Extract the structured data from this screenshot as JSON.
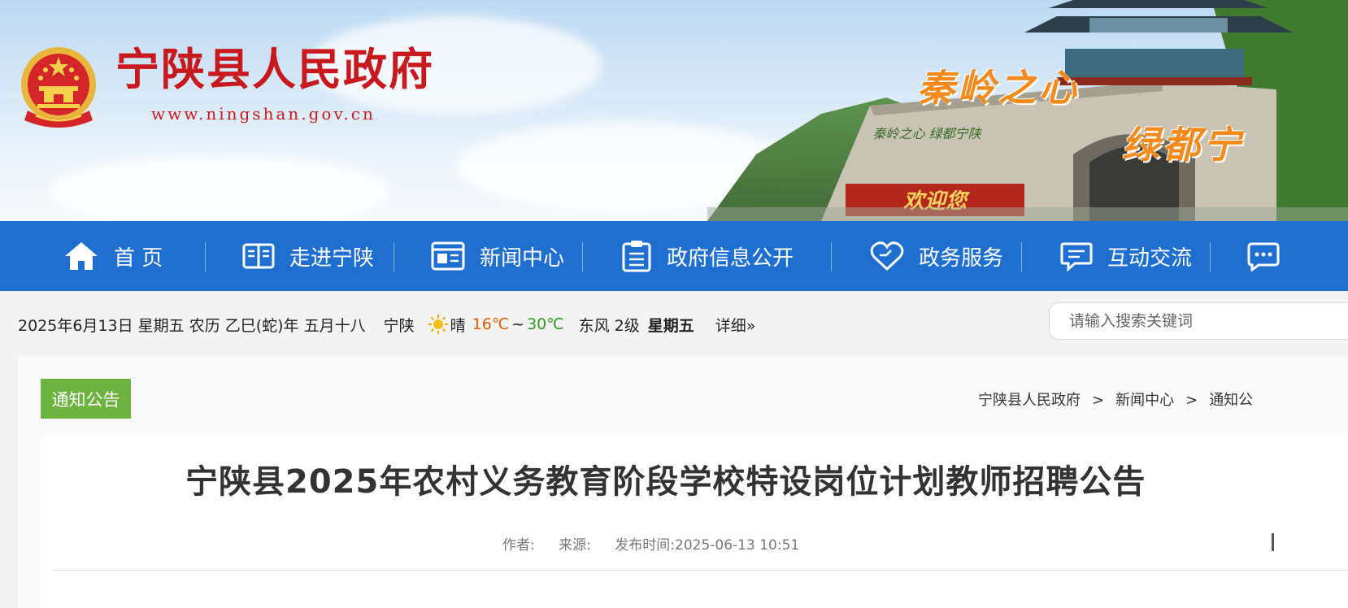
{
  "header": {
    "site_name": "宁陕县人民政府",
    "site_url": "www.ningshan.gov.cn",
    "slogan_line1": "秦岭之心",
    "slogan_line2": "绿都宁",
    "gate_text": "欢迎您",
    "wall_text": "秦岭之心 绿都宁陕"
  },
  "nav": {
    "items": [
      {
        "label": "首 页",
        "icon": "home-icon"
      },
      {
        "label": "走进宁陕",
        "icon": "book-icon"
      },
      {
        "label": "新闻中心",
        "icon": "newspaper-icon"
      },
      {
        "label": "政府信息公开",
        "icon": "clipboard-icon"
      },
      {
        "label": "政务服务",
        "icon": "heart-hand-icon"
      },
      {
        "label": "互动交流",
        "icon": "chat-icon"
      }
    ]
  },
  "infobar": {
    "date": "2025年6月13日 星期五 农历 乙巳(蛇)年 五月十八",
    "city": "宁陕",
    "weather": "晴",
    "temp_low": "16℃",
    "temp_sep": "~",
    "temp_high": "30℃",
    "wind": "东风 2级",
    "weekday": "星期五",
    "detail_link": "详细»"
  },
  "search": {
    "placeholder": "请输入搜索关键词",
    "value": ""
  },
  "category": {
    "label": "通知公告"
  },
  "breadcrumb": {
    "items": [
      "宁陕县人民政府",
      "新闻中心",
      "通知公"
    ],
    "separator": ">"
  },
  "article": {
    "title": "宁陕县2025年农村义务教育阶段学校特设岗位计划教师招聘公告",
    "author_label": "作者:",
    "source_label": "来源:",
    "publish_label": "发布时间:",
    "publish_time": "2025-06-13 10:51"
  },
  "colors": {
    "nav_blue": "#1f6fd0",
    "site_red": "#c81a1e",
    "slogan_orange": "#f28a1c",
    "tag_green": "#6db33f"
  }
}
